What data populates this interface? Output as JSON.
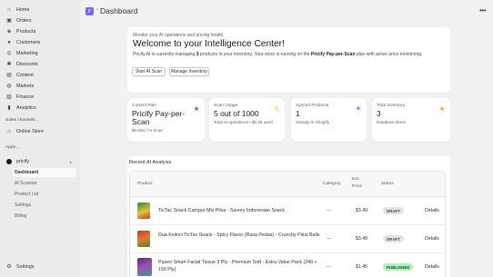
{
  "sidebar": {
    "nav": [
      {
        "label": "Home",
        "icon": "home-icon"
      },
      {
        "label": "Orders",
        "icon": "orders-icon"
      },
      {
        "label": "Products",
        "icon": "tag-icon"
      },
      {
        "label": "Customers",
        "icon": "person-icon"
      },
      {
        "label": "Marketing",
        "icon": "target-icon"
      },
      {
        "label": "Discounts",
        "icon": "discount-icon"
      },
      {
        "label": "Content",
        "icon": "content-icon"
      },
      {
        "label": "Markets",
        "icon": "globe-icon"
      },
      {
        "label": "Finance",
        "icon": "bank-icon"
      },
      {
        "label": "Analytics",
        "icon": "chart-icon"
      }
    ],
    "sales_channels_label": "Sales channels",
    "online_store_label": "Online Store",
    "apps_label": "Apps",
    "app_name": "pricify",
    "app_sub_items": [
      "Dashboard",
      "AI Scanner",
      "Product List",
      "Settings",
      "Billing"
    ],
    "settings_label": "Settings"
  },
  "header": {
    "app_badge": "P",
    "title": "Dashboard",
    "more": "•••"
  },
  "welcome": {
    "subtitle": "Monitor your AI operations and pricing health.",
    "headline": "Welcome to your Intelligence Center!",
    "desc_prefix": "Pricify AI is currently managing ",
    "desc_count": "3",
    "desc_mid": " products in your inventory. Your store is running on the ",
    "desc_plan": "Pricify Pay-per-Scan",
    "desc_suffix": " plan with active price monitoring.",
    "start_scan": "Start AI Scan",
    "manage_inventory": "Manage Inventory"
  },
  "stats": [
    {
      "label": "Current Plan",
      "value": "Pricify Pay-per-Scan",
      "note": "$0.050 / AI Scan",
      "icon": "plan-icon",
      "color": "#616161"
    },
    {
      "label": "Scan Usage",
      "value": "5 out of 1000",
      "note": "Total AI operations • $0.25 used",
      "icon": "lightning-icon",
      "color": "#e8b93c"
    },
    {
      "label": "Synced Products",
      "value": "1",
      "note": "Already in Shopify",
      "icon": "puzzle-icon",
      "color": "#5b6bd6"
    },
    {
      "label": "Total Inventory",
      "value": "3",
      "note": "Database items",
      "icon": "tag-icon",
      "color": "#e0a03a"
    }
  ],
  "recent": {
    "title": "Recent AI Analysis",
    "columns": {
      "product": "Product",
      "category": "Category",
      "est_price_1": "Est.",
      "est_price_2": "Price",
      "status": "Status"
    },
    "rows": [
      {
        "name": "TicTac Snack Campur Mix Pilus - Savory Indonesian Snack",
        "category": "—",
        "price": "$3.49",
        "status": "DRAFT",
        "action": "Details"
      },
      {
        "name": "Dua Kelinci TicTac Snack - Spicy Flavor (Rasa Pedas) - Crunchy Pilus Balls",
        "category": "—",
        "price": "$3.49",
        "status": "DRAFT",
        "action": "Details"
      },
      {
        "name": "Paseo Smart Facial Tissue 3 Ply - Premium Soft - Extra Value Pack (240 + 150 Ply)",
        "category": "—",
        "price": "$1.45",
        "status": "PUBLISHED",
        "action": "Details"
      }
    ]
  },
  "colors": {
    "draft_bg": "#e3e3e3",
    "published_bg": "#aff0b5",
    "published_text": "#0c5132",
    "accent": "#7b61ff"
  }
}
